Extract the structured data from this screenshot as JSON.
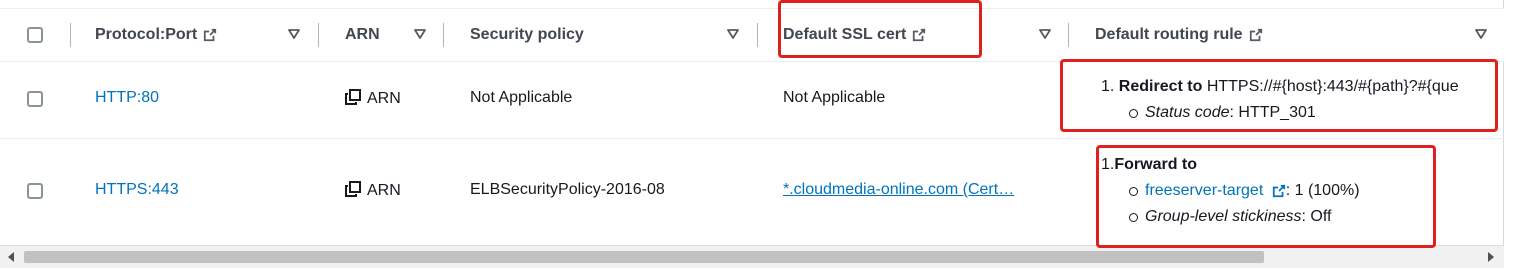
{
  "header": {
    "protocol_port": "Protocol:Port",
    "arn": "ARN",
    "security_policy": "Security policy",
    "default_ssl_cert": "Default SSL cert",
    "default_routing_rule": "Default routing rule"
  },
  "rows": [
    {
      "protocol_port": "HTTP:80",
      "arn_label": "ARN",
      "security_policy": "Not Applicable",
      "ssl_cert": "Not Applicable",
      "rule": {
        "num": "1.",
        "action": "Redirect to",
        "target": "HTTPS://#{host}:443/#{path}?#{que",
        "detail_label": "Status code",
        "detail_value": ": HTTP_301"
      }
    },
    {
      "protocol_port": "HTTPS:443",
      "arn_label": "ARN",
      "security_policy": "ELBSecurityPolicy-2016-08",
      "ssl_cert": "*.cloudmedia-online.com (Cert…",
      "rule": {
        "num": "1.",
        "action": "Forward to",
        "target_link": "freeserver-target",
        "target_weight": ": 1 (100%)",
        "detail_label": "Group-level stickiness",
        "detail_value": ": Off"
      }
    }
  ],
  "colors": {
    "link": "#0073bb",
    "highlight": "#e0201c",
    "header_text": "#414750"
  }
}
